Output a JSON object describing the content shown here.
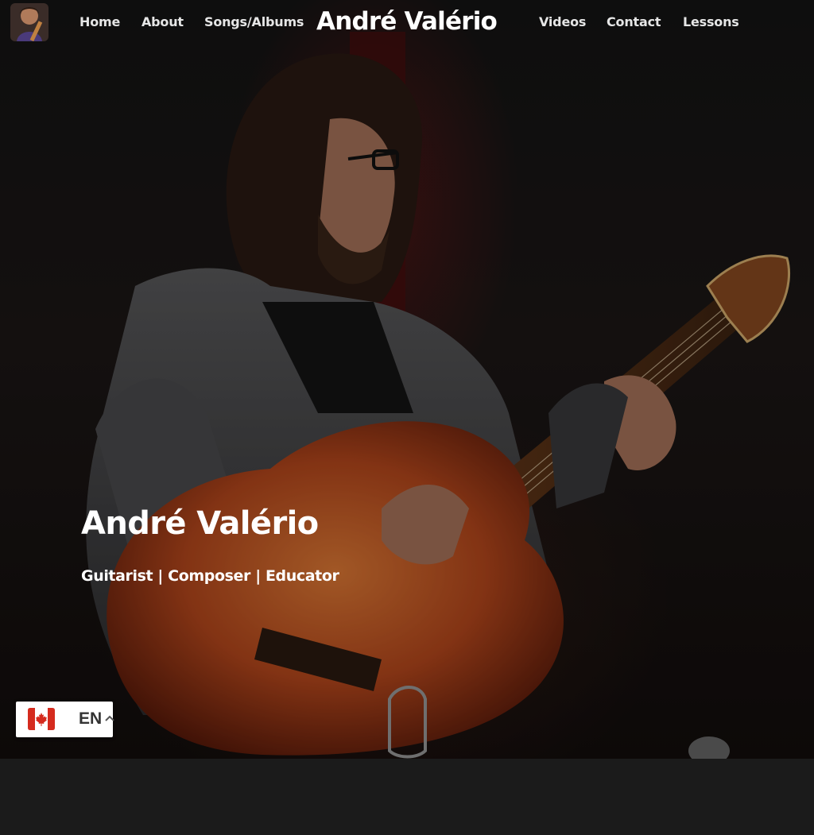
{
  "nav": {
    "avatar_alt": "André Valério",
    "links_left": [
      {
        "label": "Home"
      },
      {
        "label": "About"
      },
      {
        "label": "Songs/Albums"
      }
    ],
    "brand": "André Valério",
    "links_right": [
      {
        "label": "Videos"
      },
      {
        "label": "Contact"
      },
      {
        "label": "Lessons"
      }
    ]
  },
  "hero": {
    "title": "André Valério",
    "subtitle": "Guitarist | Composer | Educator",
    "image_icon": "guitarist-photo"
  },
  "language_switcher": {
    "flag_icon": "canada-flag-icon",
    "code": "EN",
    "chevron_icon": "chevron-up-icon"
  },
  "colors": {
    "background": "#1b1b1b",
    "text": "#ffffff",
    "guitar_body": "#b5471c"
  }
}
